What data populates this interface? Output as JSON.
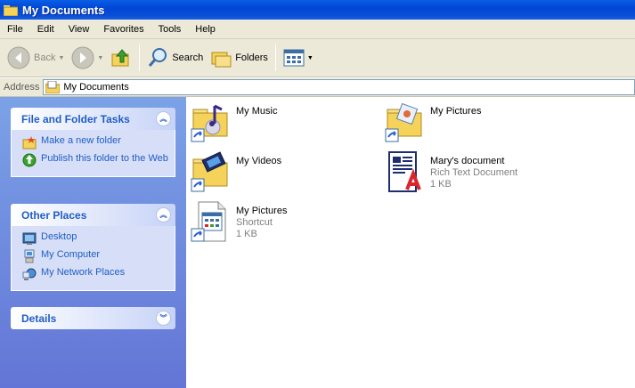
{
  "window": {
    "title": "My Documents"
  },
  "menu": [
    "File",
    "Edit",
    "View",
    "Favorites",
    "Tools",
    "Help"
  ],
  "toolbar": {
    "back": "Back",
    "search": "Search",
    "folders": "Folders"
  },
  "address": {
    "label": "Address",
    "value": "My Documents"
  },
  "sidebar": {
    "tasks": {
      "title": "File and Folder Tasks",
      "items": [
        "Make a new folder",
        "Publish this folder to the Web"
      ]
    },
    "places": {
      "title": "Other Places",
      "items": [
        "Desktop",
        "My Computer",
        "My Network Places"
      ]
    },
    "details": {
      "title": "Details"
    }
  },
  "files": [
    {
      "name": "My Music",
      "type": "",
      "size": ""
    },
    {
      "name": "My Pictures",
      "type": "",
      "size": ""
    },
    {
      "name": "My Videos",
      "type": "",
      "size": ""
    },
    {
      "name": "Mary's document",
      "type": "Rich Text Document",
      "size": "1 KB"
    },
    {
      "name": "My Pictures",
      "type": "Shortcut",
      "size": "1 KB"
    }
  ]
}
